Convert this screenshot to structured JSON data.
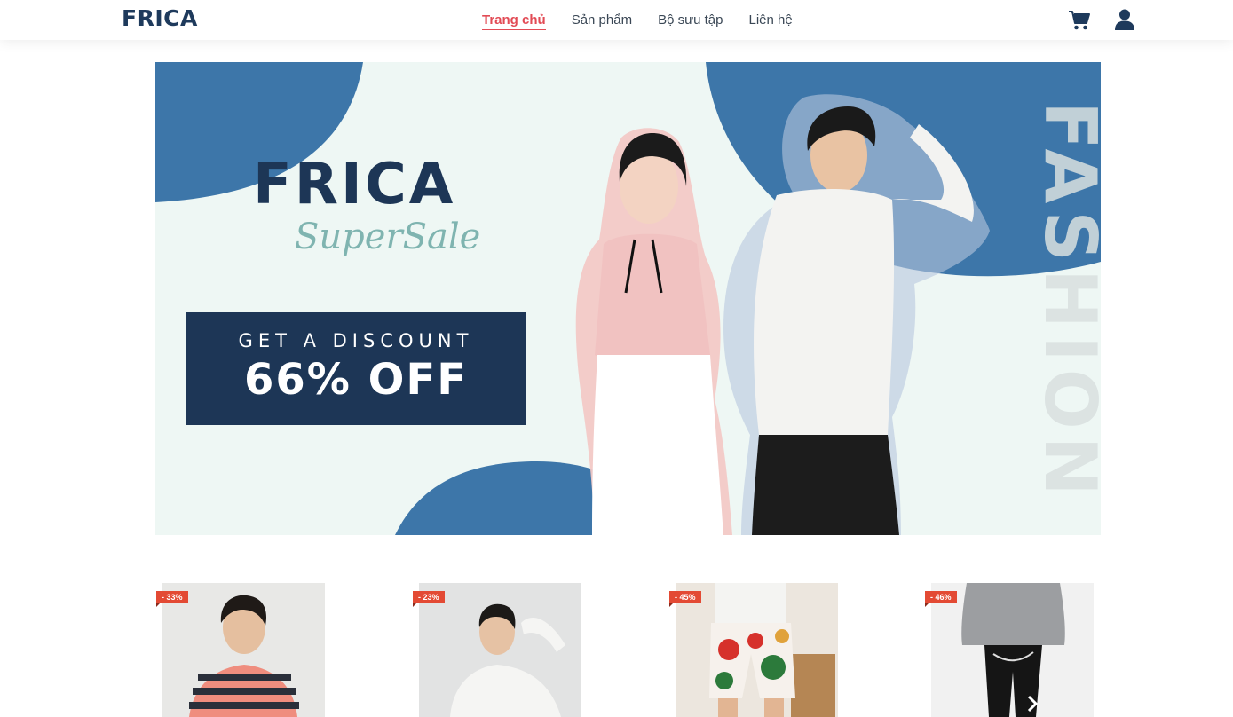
{
  "header": {
    "logo": "FRICA",
    "nav": [
      {
        "label": "Trang chủ",
        "active": true
      },
      {
        "label": "Sản phẩm",
        "active": false
      },
      {
        "label": "Bộ sưu tập",
        "active": false
      },
      {
        "label": "Liên hệ",
        "active": false
      }
    ],
    "icons": [
      "cart-icon",
      "user-icon"
    ]
  },
  "banner": {
    "title": "FRICA",
    "script": "SuperSale",
    "discount_line1": "GET A DISCOUNT",
    "discount_line2": "66% OFF",
    "vertical_text": "FASHION"
  },
  "products": [
    {
      "badge": "- 33%"
    },
    {
      "badge": "- 23%"
    },
    {
      "badge": "- 45%"
    },
    {
      "badge": "- 46%"
    }
  ],
  "colors": {
    "brand_navy": "#1d3656",
    "accent_red": "#e24b55",
    "banner_blue": "#3d76a9",
    "banner_bg": "#eef7f4",
    "badge_red": "#e34a34"
  }
}
